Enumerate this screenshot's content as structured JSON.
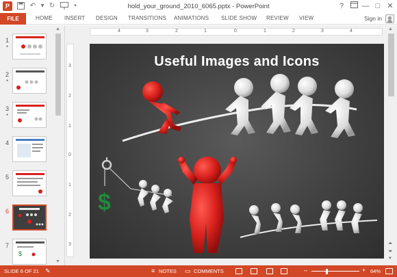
{
  "window": {
    "title": "hold_your_ground_2010_6065.pptx - PowerPoint",
    "help_label": "?",
    "minimize_label": "—",
    "restore_label": "□",
    "close_label": "✕"
  },
  "quick_access": {
    "logo_label": "P"
  },
  "ribbon": {
    "file_label": "FILE",
    "tabs": [
      "HOME",
      "INSERT",
      "DESIGN",
      "TRANSITIONS",
      "ANIMATIONS",
      "SLIDE SHOW",
      "REVIEW",
      "VIEW"
    ],
    "sign_in_label": "Sign in"
  },
  "thumbnails": [
    {
      "number": "1",
      "star": "*"
    },
    {
      "number": "2",
      "star": "*"
    },
    {
      "number": "3",
      "star": "*"
    },
    {
      "number": "4",
      "star": ""
    },
    {
      "number": "5",
      "star": ""
    },
    {
      "number": "6",
      "star": "",
      "active": true
    },
    {
      "number": "7",
      "star": ""
    }
  ],
  "rulers": {
    "horizontal_ticks": [
      "4",
      "3",
      "2",
      "1",
      "0",
      "1",
      "2",
      "3",
      "4"
    ],
    "vertical_ticks": [
      "3",
      "2",
      "1",
      "0",
      "1",
      "2",
      "3"
    ]
  },
  "slide": {
    "title": "Useful Images and Icons",
    "dollar_sign": "$"
  },
  "status_bar": {
    "slide_counter": "SLIDE 6 OF 21",
    "notes_label": "NOTES",
    "comments_label": "COMMENTS",
    "zoom_minus": "–",
    "zoom_plus": "+",
    "zoom_percent": "64%",
    "zoom_fraction": 0.64
  },
  "colors": {
    "accent": "#d24726",
    "slide_bg": "#3e3e3e",
    "figure_red": "#d8201c",
    "figure_white": "#e8e8e8",
    "dollar_green": "#1f8a3a"
  },
  "icons": [
    "powerpoint-logo",
    "save-icon",
    "undo-icon",
    "redo-icon",
    "present-icon",
    "customize-icon",
    "help-icon",
    "minimize-icon",
    "restore-icon",
    "close-icon",
    "user-avatar-icon",
    "notes-icon",
    "comments-icon",
    "normal-view-icon",
    "slide-sorter-icon",
    "reading-view-icon",
    "slideshow-icon",
    "fit-slide-icon"
  ]
}
